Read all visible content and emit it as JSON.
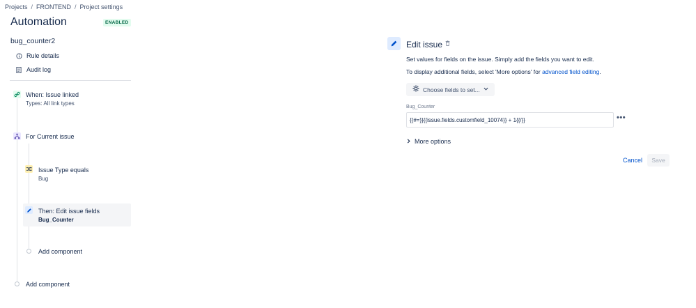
{
  "breadcrumb": {
    "items": [
      "Projects",
      "FRONTEND",
      "Project settings"
    ],
    "separator": "/"
  },
  "header": {
    "title": "Automation",
    "status_badge": "ENABLED"
  },
  "sidebar": {
    "rule_name": "bug_counter2",
    "links": [
      {
        "label": "Rule details",
        "icon": "info-icon"
      },
      {
        "label": "Audit log",
        "icon": "document-icon"
      }
    ],
    "steps": {
      "trigger": {
        "title": "When: Issue linked",
        "subtitle": "Types: All link types",
        "icon": "link-icon"
      },
      "branch": {
        "title": "For Current issue",
        "icon": "branch-icon"
      },
      "condition": {
        "title": "Issue Type equals",
        "subtitle": "Bug",
        "icon": "shuffle-icon"
      },
      "action": {
        "title": "Then: Edit issue fields",
        "subtitle": "Bug_Counter",
        "icon": "pencil-icon"
      },
      "add_component_inner": "Add component",
      "add_component_outer": "Add component"
    }
  },
  "editor": {
    "title": "Edit issue",
    "desc1": "Set values for fields on the issue. Simply add the fields you want to edit.",
    "desc2_prefix": "To display additional fields, select 'More options' for ",
    "desc2_link": "advanced field editing",
    "desc2_suffix": ".",
    "choose_fields_label": "Choose fields to set...",
    "field": {
      "label": "Bug_Counter",
      "value": "{{#=}}{{issue.fields.customfield_10074}} + 1{{/}}"
    },
    "more_options_label": "More options",
    "cancel_label": "Cancel",
    "save_label": "Save"
  },
  "colors": {
    "accent": "#0052cc",
    "enabled_green": "#006644",
    "enabled_bg": "#e3fcef",
    "selected_bg": "#f4f5f7"
  }
}
